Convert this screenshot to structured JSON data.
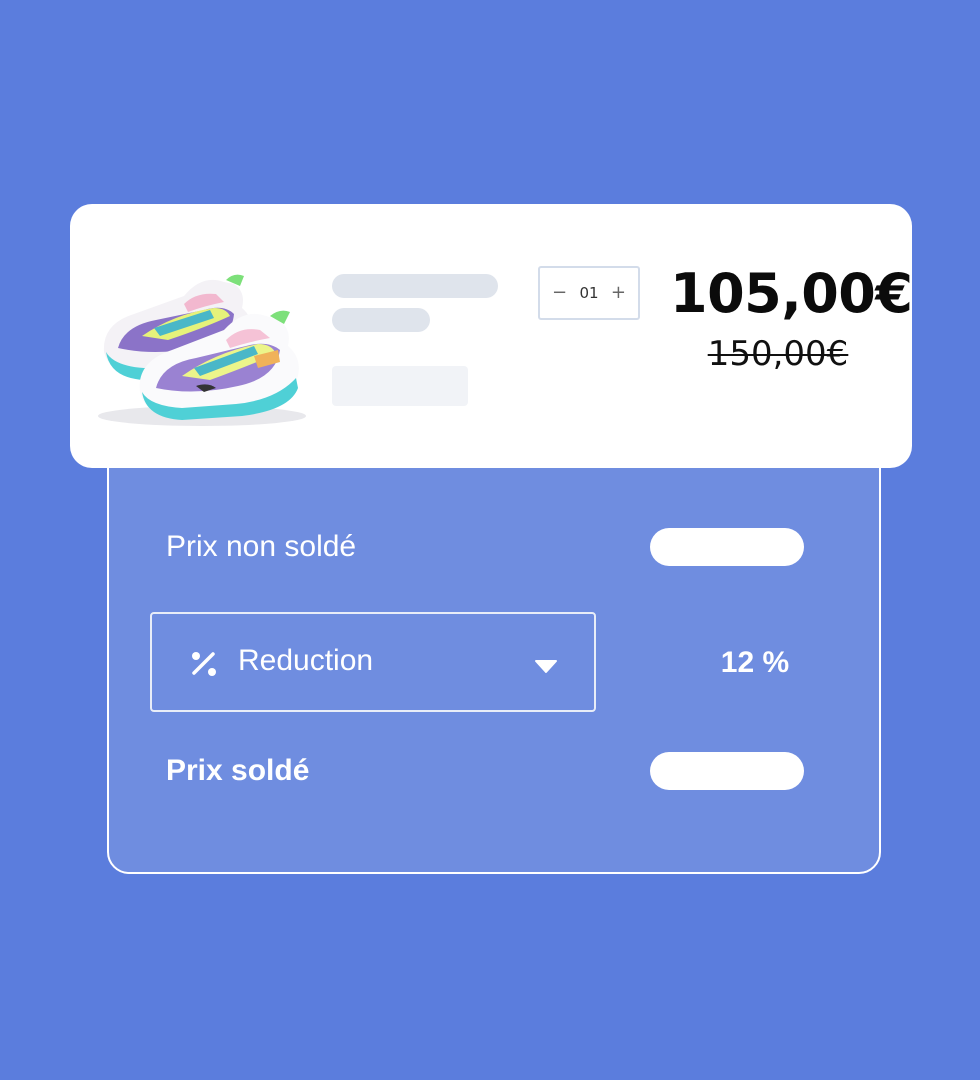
{
  "product": {
    "quantity": "01",
    "minus": "−",
    "plus": "+",
    "price": "105,00€",
    "original_price": "150,00€"
  },
  "summary": {
    "unsold_label": "Prix non soldé",
    "discount_select": "Reduction",
    "discount_value": "12 %",
    "sold_label": "Prix soldé"
  },
  "colors": {
    "background": "#5b7ddd",
    "panel": "#6f8de0",
    "card": "#ffffff"
  },
  "icons": [
    "sneaker-image",
    "percent-icon",
    "caret-down-icon"
  ]
}
